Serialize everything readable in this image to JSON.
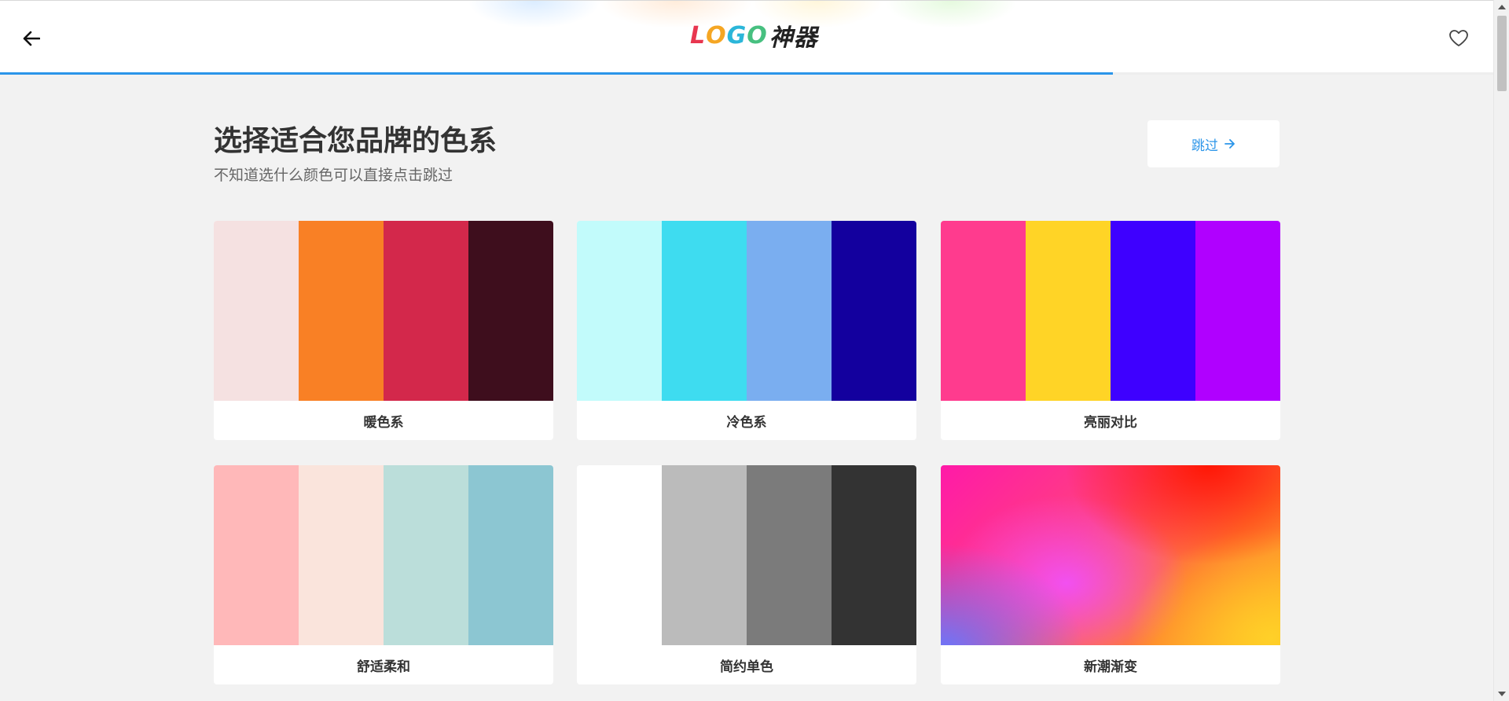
{
  "header": {
    "logo": {
      "part1": "L",
      "part2": "O",
      "part3": "G",
      "part4": "O",
      "suffix": "神器"
    },
    "progress_percent": 74.5
  },
  "main": {
    "title": "选择适合您品牌的色系",
    "subtitle": "不知道选什么颜色可以直接点击跳过",
    "skip_label": "跳过"
  },
  "icons": {
    "back": "arrow-left-icon",
    "favorite": "heart-icon",
    "skip_arrow": "arrow-right-icon"
  },
  "palettes": [
    {
      "label": "暖色系",
      "colors": [
        "#f5e1e1",
        "#f98025",
        "#d3284b",
        "#3e0e1d"
      ]
    },
    {
      "label": "冷色系",
      "colors": [
        "#c2fbfb",
        "#3edcf0",
        "#7aaef0",
        "#13009e"
      ]
    },
    {
      "label": "亮丽对比",
      "colors": [
        "#ff3b8e",
        "#ffd426",
        "#3e00ff",
        "#b000ff"
      ]
    },
    {
      "label": "舒适柔和",
      "colors": [
        "#ffb8b9",
        "#fae4dc",
        "#bbdeda",
        "#8cc6d2"
      ]
    },
    {
      "label": "简约单色",
      "colors": [
        "#ffffff",
        "#bbbbbb",
        "#7b7b7b",
        "#333333"
      ]
    },
    {
      "label": "新潮渐变",
      "gradient": true
    }
  ]
}
